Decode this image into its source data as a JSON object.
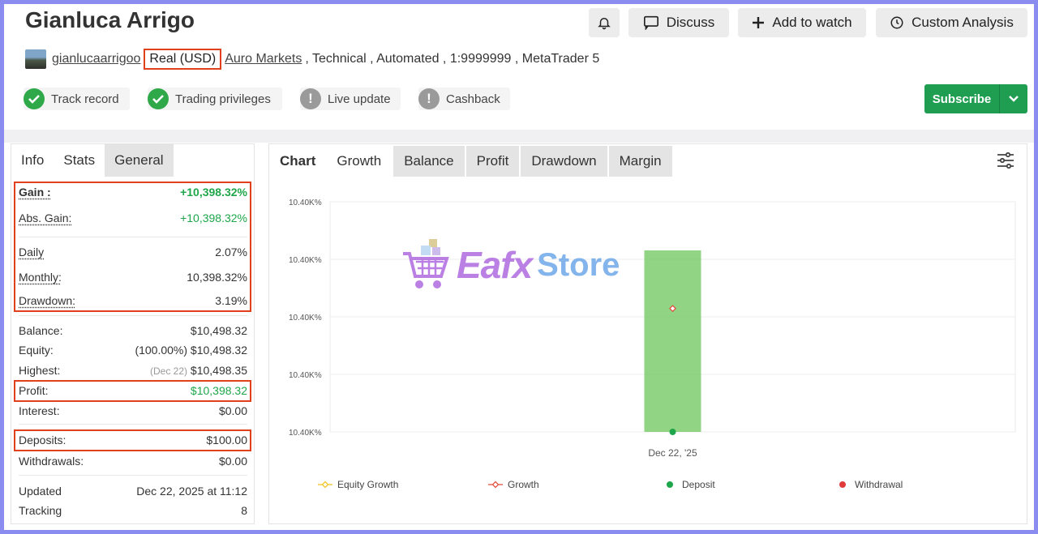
{
  "header": {
    "title": "Gianluca Arrigo",
    "buttons": {
      "discuss": "Discuss",
      "add_to_watch": "Add to watch",
      "custom_analysis": "Custom Analysis"
    }
  },
  "meta": {
    "username": "gianlucaarrigoo",
    "account_type": "Real (USD)",
    "broker": "Auro Markets",
    "details": ", Technical , Automated , 1:9999999 , MetaTrader 5"
  },
  "badges": [
    "Track record",
    "Trading privileges",
    "Live update",
    "Cashback"
  ],
  "subscribe_label": "Subscribe",
  "left_tabs": [
    "Info",
    "Stats",
    "General"
  ],
  "stats": {
    "gain": {
      "label": "Gain :",
      "value": "+10,398.32%"
    },
    "abs_gain": {
      "label": "Abs. Gain:",
      "value": "+10,398.32%"
    },
    "daily": {
      "label": "Daily",
      "value": "2.07%"
    },
    "monthly": {
      "label": "Monthly:",
      "value": "10,398.32%"
    },
    "drawdown": {
      "label": "Drawdown:",
      "value": "3.19%"
    },
    "balance": {
      "label": "Balance:",
      "value": "$10,498.32"
    },
    "equity": {
      "label": "Equity:",
      "pct": "(100.00%)",
      "value": "$10,498.32"
    },
    "highest": {
      "label": "Highest:",
      "date": "(Dec 22)",
      "value": "$10,498.35"
    },
    "profit": {
      "label": "Profit:",
      "value": "$10,398.32"
    },
    "interest": {
      "label": "Interest:",
      "value": "$0.00"
    },
    "deposits": {
      "label": "Deposits:",
      "value": "$100.00"
    },
    "withdrawals": {
      "label": "Withdrawals:",
      "value": "$0.00"
    },
    "updated": {
      "label": "Updated",
      "value": "Dec 22, 2025 at 11:12"
    },
    "tracking": {
      "label": "Tracking",
      "value": "8"
    }
  },
  "chart_tabs": [
    "Chart",
    "Growth",
    "Balance",
    "Profit",
    "Drawdown",
    "Margin"
  ],
  "watermark": {
    "part1": "Eafx",
    "part2": "Store"
  },
  "chart_data": {
    "type": "bar",
    "categories": [
      "Dec 22, '25"
    ],
    "y_tick_labels": [
      "10.40K%",
      "10.40K%",
      "10.40K%",
      "10.40K%",
      "10.40K%"
    ],
    "series": [
      {
        "name": "Equity Growth",
        "kind": "line",
        "color": "#f2c21b"
      },
      {
        "name": "Growth",
        "kind": "line",
        "color": "#e24a3b",
        "marker_fraction": 0.68
      },
      {
        "name": "Deposit",
        "kind": "dot",
        "color": "#1ea64a",
        "marker_fraction": 0.0
      },
      {
        "name": "Withdrawal",
        "kind": "dot",
        "color": "#e03a3a"
      }
    ],
    "bar": {
      "color": "#7dcc6e",
      "fill_fraction": 1.0
    },
    "grid": true,
    "legend_position": "bottom"
  }
}
